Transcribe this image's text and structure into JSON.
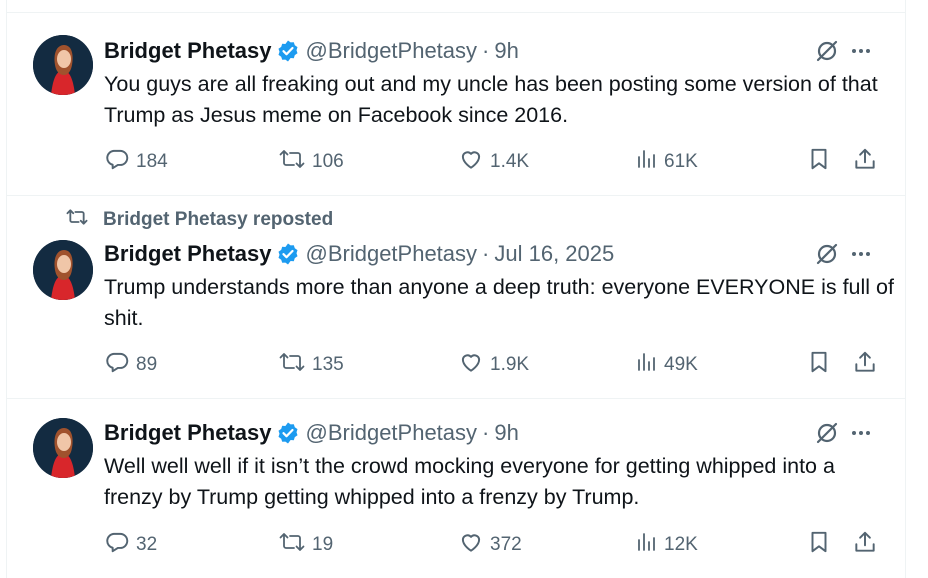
{
  "tweets": [
    {
      "author": {
        "name": "Bridget Phetasy",
        "handle": "@BridgetPhetasy"
      },
      "separator": "·",
      "time": "9h",
      "text": "You guys are all freaking out and my uncle has been posting some version of that Trump as Jesus meme on Facebook since 2016.",
      "stats": {
        "replies": "184",
        "reposts": "106",
        "likes": "1.4K",
        "views": "61K"
      }
    },
    {
      "repost_label": "Bridget Phetasy reposted",
      "author": {
        "name": "Bridget Phetasy",
        "handle": "@BridgetPhetasy"
      },
      "separator": "·",
      "time": "Jul 16, 2025",
      "text": "Trump understands more than anyone a deep truth: everyone EVERYONE is full of shit.",
      "stats": {
        "replies": "89",
        "reposts": "135",
        "likes": "1.9K",
        "views": "49K"
      }
    },
    {
      "author": {
        "name": "Bridget Phetasy",
        "handle": "@BridgetPhetasy"
      },
      "separator": "·",
      "time": "9h",
      "text": "Well well well if it isn’t the crowd mocking everyone for getting whipped into a frenzy by Trump getting whipped into a frenzy by Trump.",
      "stats": {
        "replies": "32",
        "reposts": "19",
        "likes": "372",
        "views": "12K"
      }
    }
  ],
  "icons": {
    "verified": "verified-badge-icon",
    "grok": "grok-icon",
    "more": "more-icon",
    "reply": "reply-icon",
    "repost": "repost-icon",
    "like": "like-icon",
    "views": "views-icon",
    "bookmark": "bookmark-icon",
    "share": "share-icon"
  },
  "colors": {
    "text": "#0f1419",
    "secondary": "#536471",
    "verified": "#1d9bf0",
    "divider": "#eff3f4"
  }
}
